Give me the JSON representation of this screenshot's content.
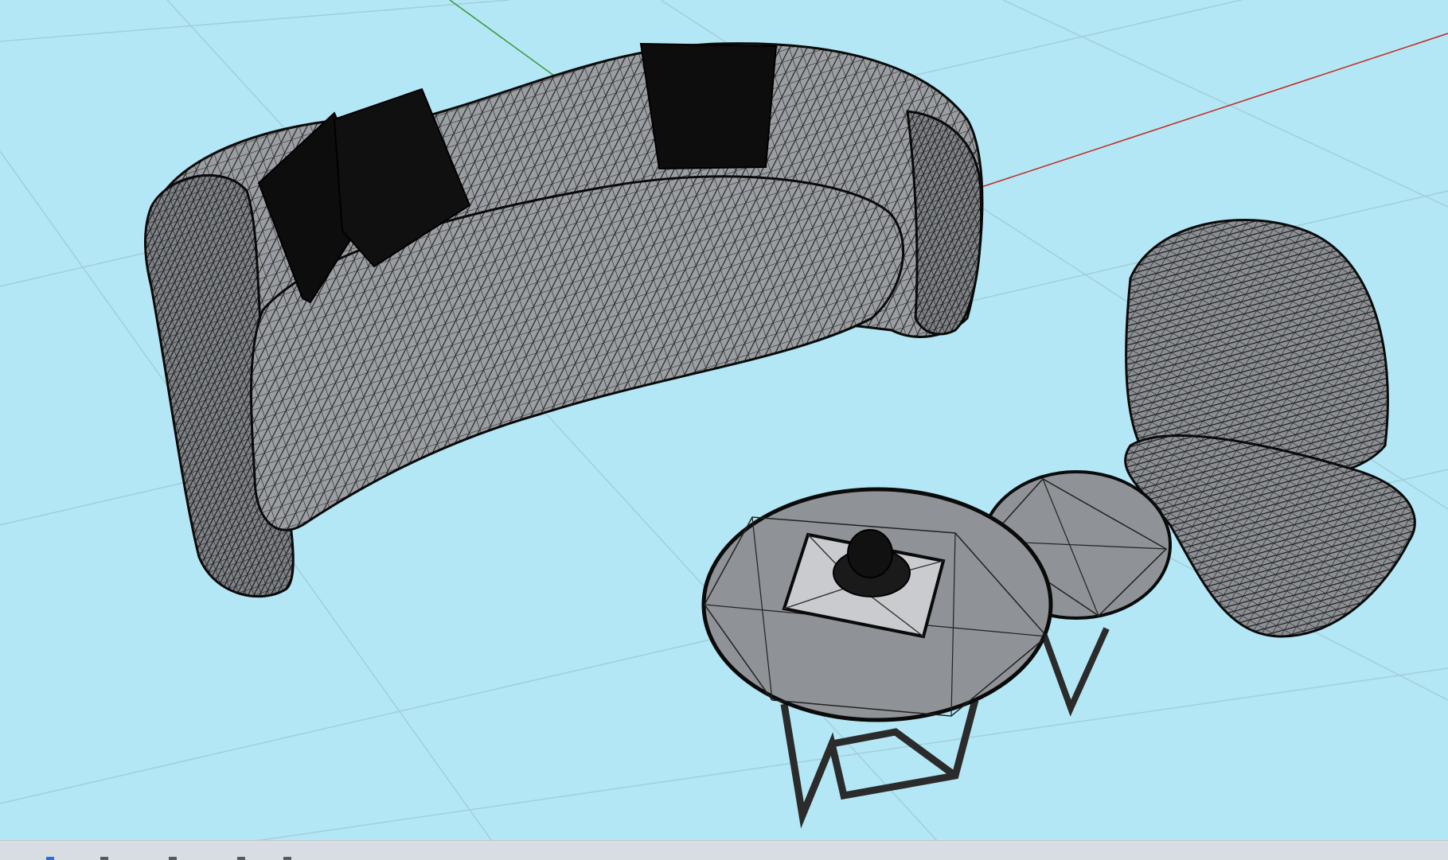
{
  "viewport": {
    "background_color": "#b4e7f5",
    "grid_color": "#9fc9d6",
    "axis_colors": {
      "x": "#c0302a",
      "y": "#3f9a3f"
    },
    "mesh_fill": "#8f9296",
    "mesh_stroke": "#111111",
    "cushion_fill": "#0d0d0d",
    "objects": [
      "sofa",
      "pillow",
      "pillow",
      "pillow",
      "lounge-chair",
      "coffee-table",
      "side-table",
      "tray",
      "decor-object"
    ]
  },
  "bottom_bar": {
    "background_color": "#d8dde3",
    "accent_color": "#2a6fd6"
  }
}
